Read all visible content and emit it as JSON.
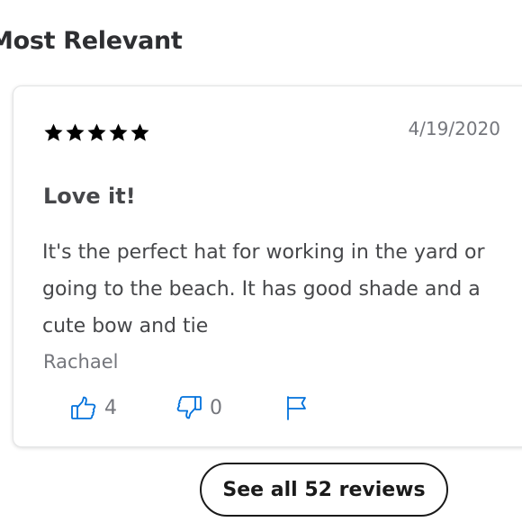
{
  "section": {
    "title": "Most Relevant"
  },
  "review": {
    "rating": 5,
    "rating_max": 5,
    "date": "4/19/2020",
    "title": "Love it!",
    "body": "It's the perfect hat for working in the yard or going to the beach. It has good shade and a cute bow and tie",
    "author": "Rachael",
    "helpful_count": "4",
    "unhelpful_count": "0",
    "icons": {
      "star": "star-icon",
      "helpful": "thumbs-up-icon",
      "unhelpful": "thumbs-down-icon",
      "report": "flag-icon"
    }
  },
  "actions": {
    "see_all_label": "See all 52 reviews"
  },
  "colors": {
    "star": "#000000",
    "feedback_icon": "#0071dc",
    "muted_text": "#74767c",
    "body_text": "#46474a"
  }
}
